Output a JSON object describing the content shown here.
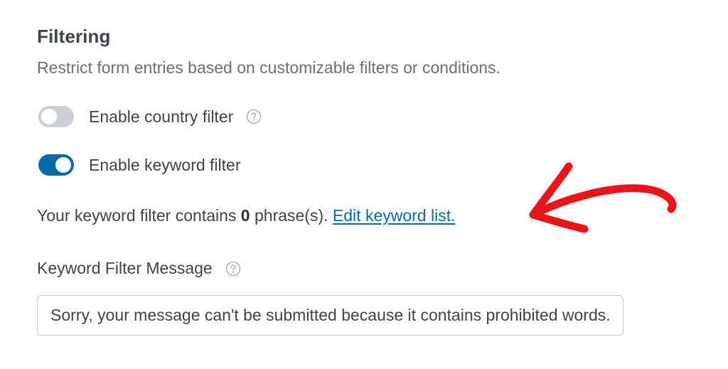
{
  "filtering": {
    "title": "Filtering",
    "subtitle": "Restrict form entries based on customizable filters or conditions."
  },
  "country_filter": {
    "label": "Enable country filter",
    "enabled": false,
    "help_icon": "question-circle-icon"
  },
  "keyword_filter": {
    "label": "Enable keyword filter",
    "enabled": true,
    "info_prefix": "Your keyword filter contains ",
    "phrase_count": "0",
    "info_suffix": " phrase(s). ",
    "edit_link": "Edit keyword list."
  },
  "keyword_message": {
    "label": "Keyword Filter Message",
    "help_icon": "question-circle-icon",
    "value": "Sorry, your message can't be submitted because it contains prohibited words."
  },
  "colors": {
    "toggle_on": "#056aab",
    "toggle_off": "#cccfd3",
    "link": "#056aab",
    "annotation_arrow": "#e8161b"
  },
  "annotation": {
    "icon": "red-arrow-icon"
  }
}
